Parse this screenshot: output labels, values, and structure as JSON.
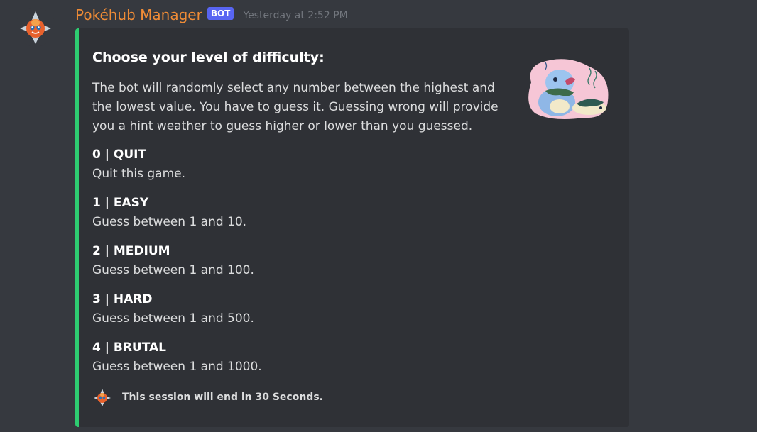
{
  "message": {
    "author": "Pokéhub Manager",
    "bot_tag": "BOT",
    "timestamp": "Yesterday at 2:52 PM",
    "avatar_icon": "rotom-pokemon-icon",
    "username_color": "#f08c36"
  },
  "embed": {
    "accent_color": "#2ecc71",
    "title": "Choose your level of difficulty:",
    "description": "The bot will randomly select any number between the highest and the lowest value. You have to guess it. Guessing wrong will provide you a hint weather to guess higher or lower than you guessed.",
    "thumbnail": "totodile-cyndaquil-sticker",
    "fields": [
      {
        "name": "0 | QUIT",
        "value": "Quit this game."
      },
      {
        "name": "1 | EASY",
        "value": "Guess between 1 and 10."
      },
      {
        "name": "2 | MEDIUM",
        "value": "Guess between 1 and 100."
      },
      {
        "name": "3 | HARD",
        "value": "Guess between 1 and 500."
      },
      {
        "name": "4 | BRUTAL",
        "value": "Guess between 1 and 1000."
      }
    ],
    "footer": {
      "icon": "rotom-pokemon-icon",
      "text": "This session will end in 30 Seconds."
    }
  }
}
